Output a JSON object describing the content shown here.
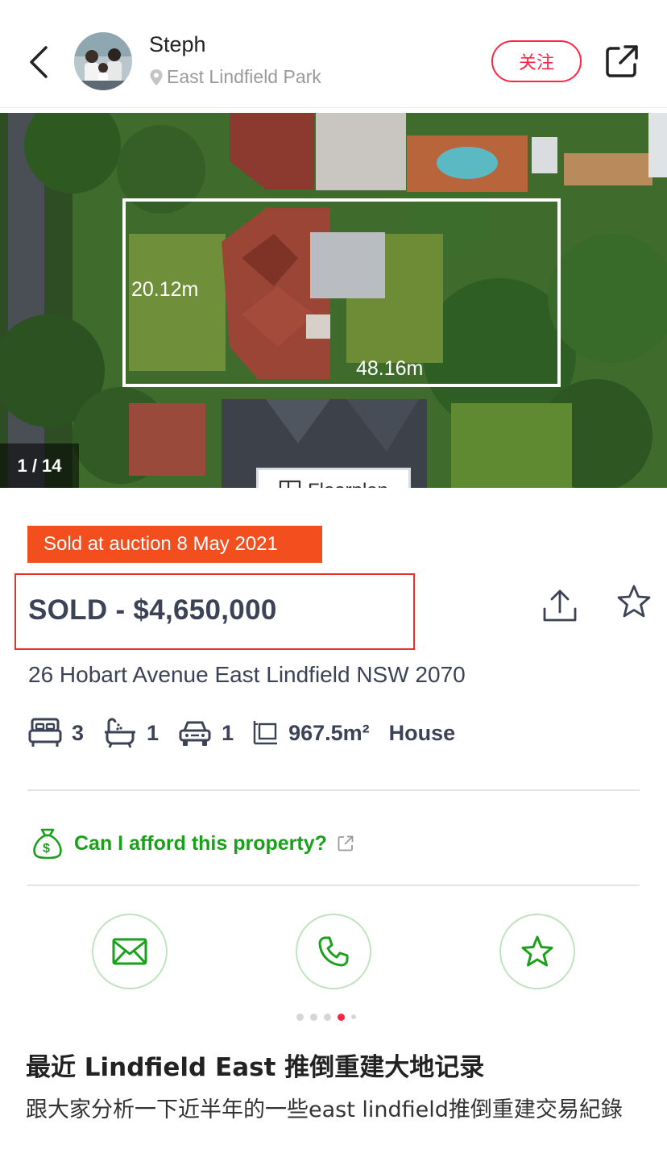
{
  "header": {
    "author_name": "Steph",
    "location": "East Lindfield Park",
    "follow_label": "关注",
    "icons": {
      "back": "chevron-left-icon",
      "share": "external-share-icon",
      "location": "location-pin-icon"
    }
  },
  "photo": {
    "counter": "1 / 14",
    "dimension_width": "20.12m",
    "dimension_length": "48.16m",
    "floorplan_label": "Floorplan"
  },
  "listing": {
    "sold_badge": "Sold at auction 8 May 2021",
    "price": "SOLD - $4,650,000",
    "address": "26 Hobart Avenue East Lindfield NSW 2070",
    "features": {
      "bedrooms": "3",
      "bathrooms": "1",
      "parking": "1",
      "land_size": "967.5m²",
      "property_type": "House"
    },
    "afford_link": "Can I afford this property?",
    "actions": [
      "email-icon",
      "phone-icon",
      "star-icon"
    ],
    "colors": {
      "accent_green": "#1aa01a",
      "sold_orange": "#f24e1e",
      "highlight_red": "#e5322a",
      "text_dark": "#3d4356"
    }
  },
  "post": {
    "carousel": {
      "total": 5,
      "active_index": 4
    },
    "title": "最近 Lindfield East 推倒重建大地记录",
    "body": "跟大家分析一下近半年的一些east lindfield推倒重建交易紀錄"
  }
}
